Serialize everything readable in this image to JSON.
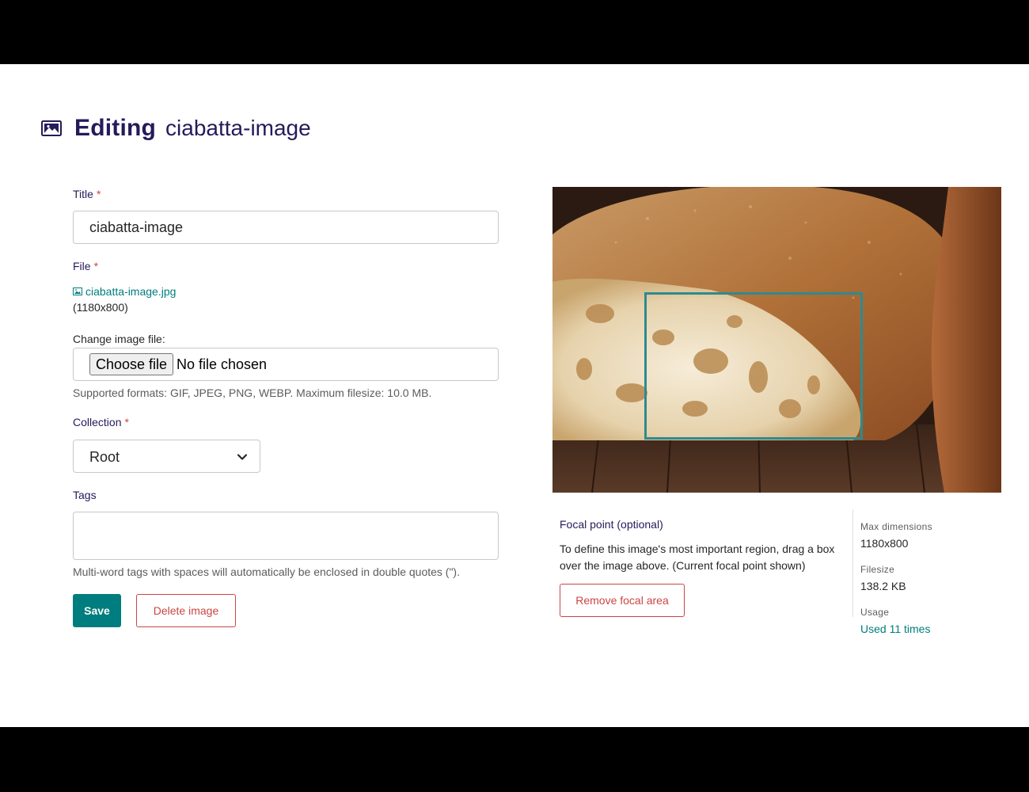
{
  "header": {
    "bold": "Editing",
    "name": "ciabatta-image",
    "icon": "image-icon"
  },
  "form": {
    "title_label": "Title",
    "title_value": "ciabatta-image",
    "required_marker": "*",
    "file_label": "File",
    "file_name": "ciabatta-image.jpg",
    "file_dimensions": "(1180x800)",
    "change_label": "Change image file:",
    "choose_button": "Choose file",
    "no_file": "No file chosen",
    "file_help": "Supported formats: GIF, JPEG, PNG, WEBP. Maximum filesize: 10.0 MB.",
    "collection_label": "Collection",
    "collection_value": "Root",
    "tags_label": "Tags",
    "tags_value": "",
    "tags_help": "Multi-word tags with spaces will automatically be enclosed in double quotes (\").",
    "save_button": "Save",
    "delete_button": "Delete image"
  },
  "focal": {
    "title": "Focal point",
    "optional": "(optional)",
    "description": "To define this image's most important region, drag a box over the image above. (Current focal point shown)",
    "remove_button": "Remove focal area"
  },
  "meta": {
    "max_dimensions_label": "Max dimensions",
    "max_dimensions_value": "1180x800",
    "filesize_label": "Filesize",
    "filesize_value": "138.2 KB",
    "usage_label": "Usage",
    "usage_value": "Used 11 times"
  },
  "colors": {
    "primary": "#007d7e",
    "heading": "#261a5a",
    "danger": "#cd4444",
    "focal_box": "#2e8a8e"
  }
}
